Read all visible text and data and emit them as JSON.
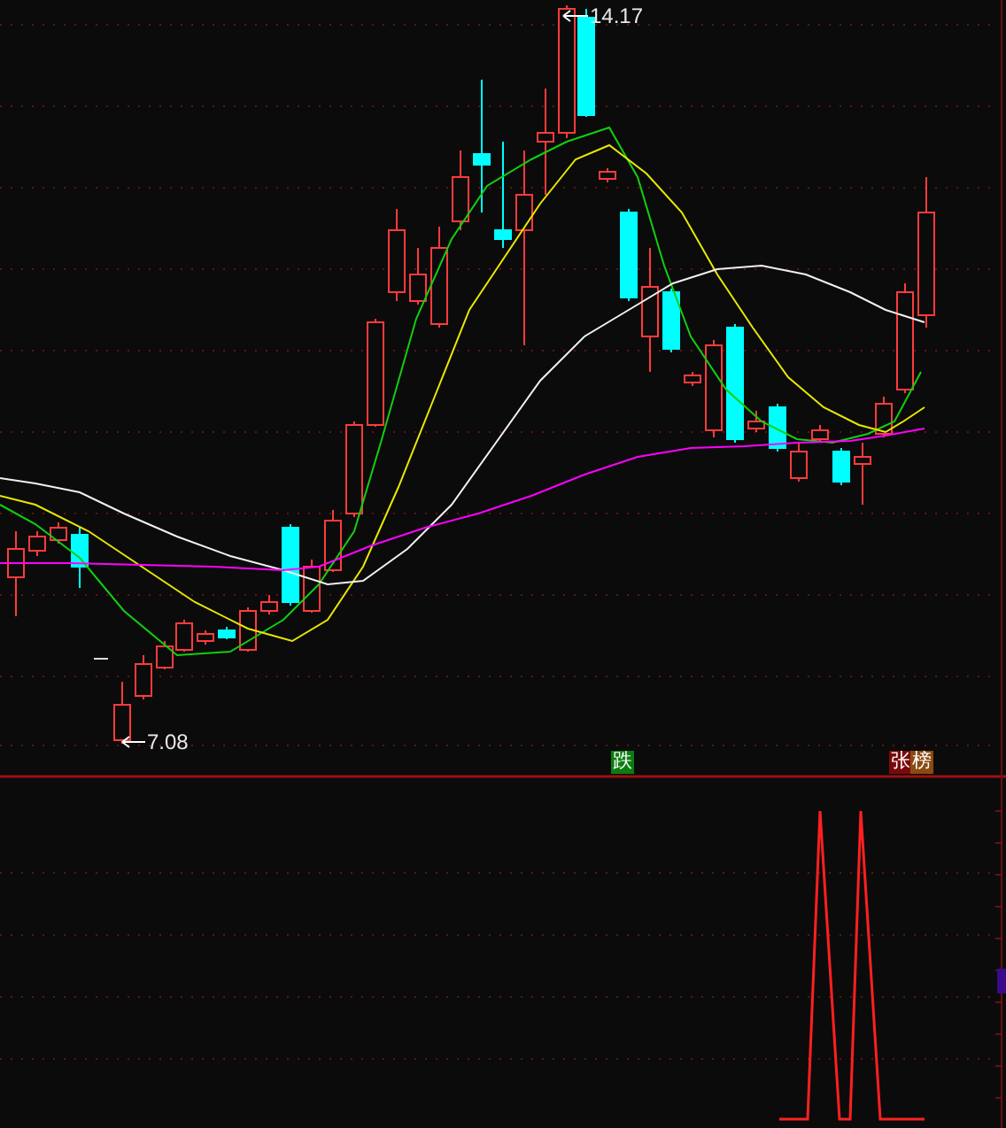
{
  "price_pane": {
    "high_label": "14.17",
    "low_label": "7.08"
  },
  "signals": [
    {
      "text": "跌",
      "color": "#0b7d10"
    },
    {
      "text": "张",
      "color": "#7a0a0a"
    },
    {
      "text": "榜",
      "color": "#8a4a10"
    }
  ]
}
